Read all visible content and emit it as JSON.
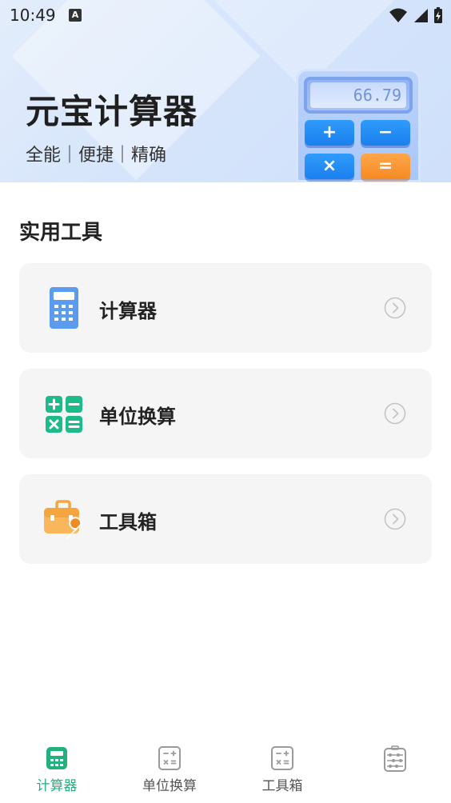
{
  "status": {
    "time": "10:49",
    "notif_badge": "A"
  },
  "header": {
    "title": "元宝计算器",
    "slogan": "全能｜便捷｜精确",
    "illustration": {
      "display": "66.79",
      "keys": [
        "+",
        "−",
        "×",
        "="
      ]
    }
  },
  "section": {
    "title": "实用工具"
  },
  "tools": [
    {
      "label": "计算器",
      "icon": "calculator-icon"
    },
    {
      "label": "单位换算",
      "icon": "unit-convert-icon"
    },
    {
      "label": "工具箱",
      "icon": "toolbox-icon"
    }
  ],
  "nav": {
    "items": [
      {
        "label": "计算器",
        "icon": "calculator-icon",
        "active": true
      },
      {
        "label": "单位换算",
        "icon": "unit-convert-icon",
        "active": false
      },
      {
        "label": "工具箱",
        "icon": "toolbox-icon",
        "active": false
      },
      {
        "label": "",
        "icon": "abacus-icon",
        "active": false
      }
    ]
  },
  "colors": {
    "accent_green": "#22b07d",
    "header_blue": "#d6e5fb",
    "card_bg": "#f5f5f5"
  }
}
